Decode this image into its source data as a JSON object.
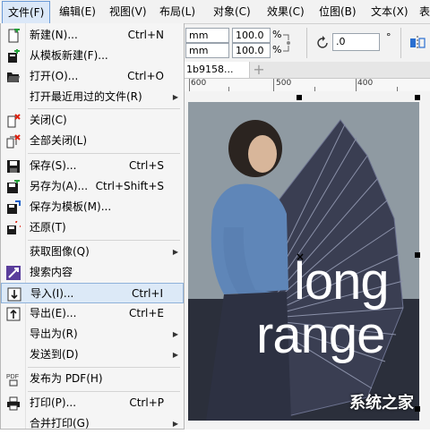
{
  "menubar": {
    "items": [
      "文件(F)",
      "编辑(E)",
      "视图(V)",
      "布局(L)",
      "对象(C)",
      "效果(C)",
      "位图(B)",
      "文本(X)",
      "表"
    ]
  },
  "propbar": {
    "unit1": "mm",
    "unit2": "mm",
    "scale_x": "100.0",
    "scale_y": "100.0",
    "pct1": "%",
    "pct2": "%",
    "rotation": ".0",
    "rotation_unit": "°"
  },
  "document_tab": {
    "title": "1b9158..."
  },
  "ruler": {
    "labels": [
      "600",
      "500",
      "400"
    ]
  },
  "file_menu": {
    "items": [
      {
        "label": "新建(N)...",
        "shortcut": "Ctrl+N",
        "icon": "new-doc-icon"
      },
      {
        "label": "从模板新建(F)...",
        "shortcut": "",
        "icon": "template-new-icon"
      },
      {
        "label": "打开(O)...",
        "shortcut": "Ctrl+O",
        "icon": "open-folder-icon"
      },
      {
        "label": "打开最近用过的文件(R)",
        "shortcut": "",
        "icon": "",
        "submenu": true
      },
      {
        "label": "关闭(C)",
        "shortcut": "",
        "icon": "close-doc-icon"
      },
      {
        "label": "全部关闭(L)",
        "shortcut": "",
        "icon": "close-all-icon"
      },
      {
        "label": "保存(S)...",
        "shortcut": "Ctrl+S",
        "icon": "save-icon"
      },
      {
        "label": "另存为(A)...",
        "shortcut": "Ctrl+Shift+S",
        "icon": "save-as-icon"
      },
      {
        "label": "保存为模板(M)...",
        "shortcut": "",
        "icon": "save-template-icon"
      },
      {
        "label": "还原(T)",
        "shortcut": "",
        "icon": "revert-icon"
      },
      {
        "label": "获取图像(Q)",
        "shortcut": "",
        "icon": "",
        "submenu": true
      },
      {
        "label": "搜索内容",
        "shortcut": "",
        "icon": "search-content-icon"
      },
      {
        "label": "导入(I)...",
        "shortcut": "Ctrl+I",
        "icon": "import-icon",
        "highlighted": true
      },
      {
        "label": "导出(E)...",
        "shortcut": "Ctrl+E",
        "icon": "export-icon"
      },
      {
        "label": "导出为(R)",
        "shortcut": "",
        "icon": "",
        "submenu": true
      },
      {
        "label": "发送到(D)",
        "shortcut": "",
        "icon": "",
        "submenu": true
      },
      {
        "label": "发布为 PDF(H)",
        "shortcut": "",
        "icon": "pdf-icon"
      },
      {
        "label": "打印(P)...",
        "shortcut": "Ctrl+P",
        "icon": "print-icon"
      },
      {
        "label": "合并打印(G)",
        "shortcut": "",
        "icon": "",
        "submenu": true
      }
    ]
  },
  "canvas": {
    "headline_1": "long",
    "headline_2": "range",
    "watermark": "系统之家"
  }
}
